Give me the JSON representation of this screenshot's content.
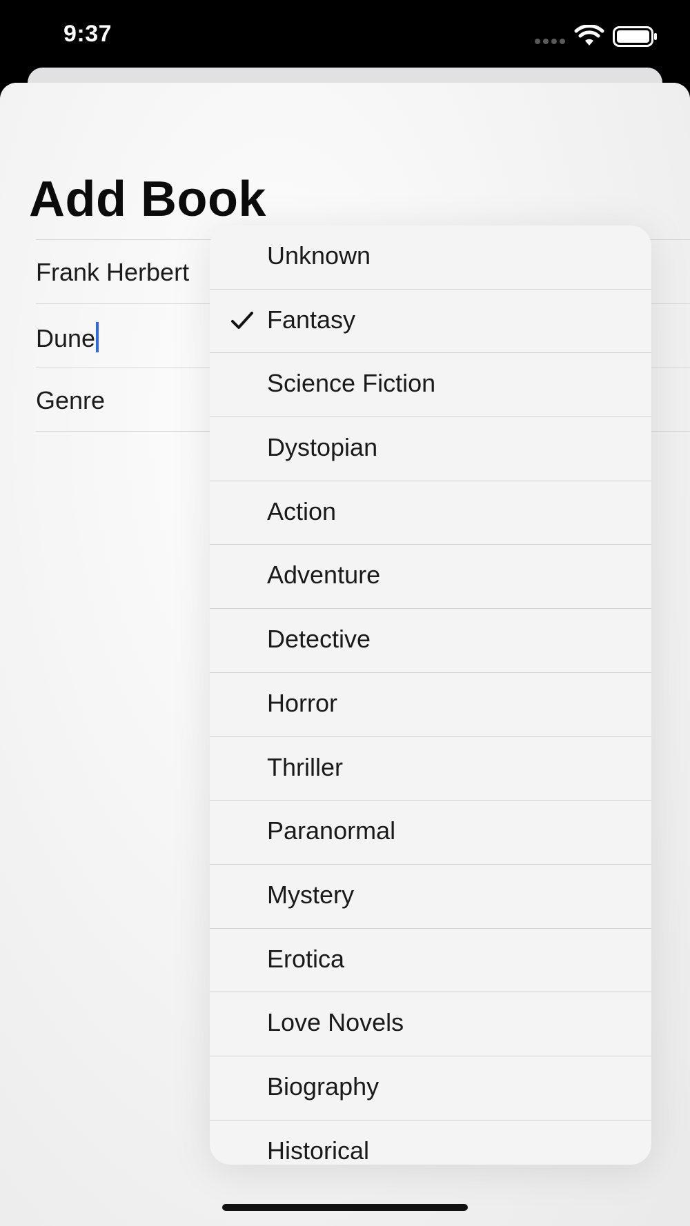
{
  "status_bar": {
    "time": "9:37"
  },
  "icons": {
    "signal": "signal-dots-icon",
    "wifi": "wifi-icon",
    "battery": "battery-icon",
    "check": "checkmark-icon"
  },
  "colors": {
    "caret": "#2b66f6",
    "background": "#000000",
    "sheet": "#f2f2f2"
  },
  "page": {
    "title": "Add Book"
  },
  "form": {
    "author": "Frank Herbert",
    "title": "Dune",
    "genre_label": "Genre"
  },
  "genre_menu": {
    "selected": "Fantasy",
    "items": [
      {
        "label": "Unknown"
      },
      {
        "label": "Fantasy"
      },
      {
        "label": "Science Fiction"
      },
      {
        "label": "Dystopian"
      },
      {
        "label": "Action"
      },
      {
        "label": "Adventure"
      },
      {
        "label": "Detective"
      },
      {
        "label": "Horror"
      },
      {
        "label": "Thriller"
      },
      {
        "label": "Paranormal"
      },
      {
        "label": "Mystery"
      },
      {
        "label": "Erotica"
      },
      {
        "label": "Love Novels"
      },
      {
        "label": "Biography"
      },
      {
        "label": "Historical"
      }
    ]
  }
}
